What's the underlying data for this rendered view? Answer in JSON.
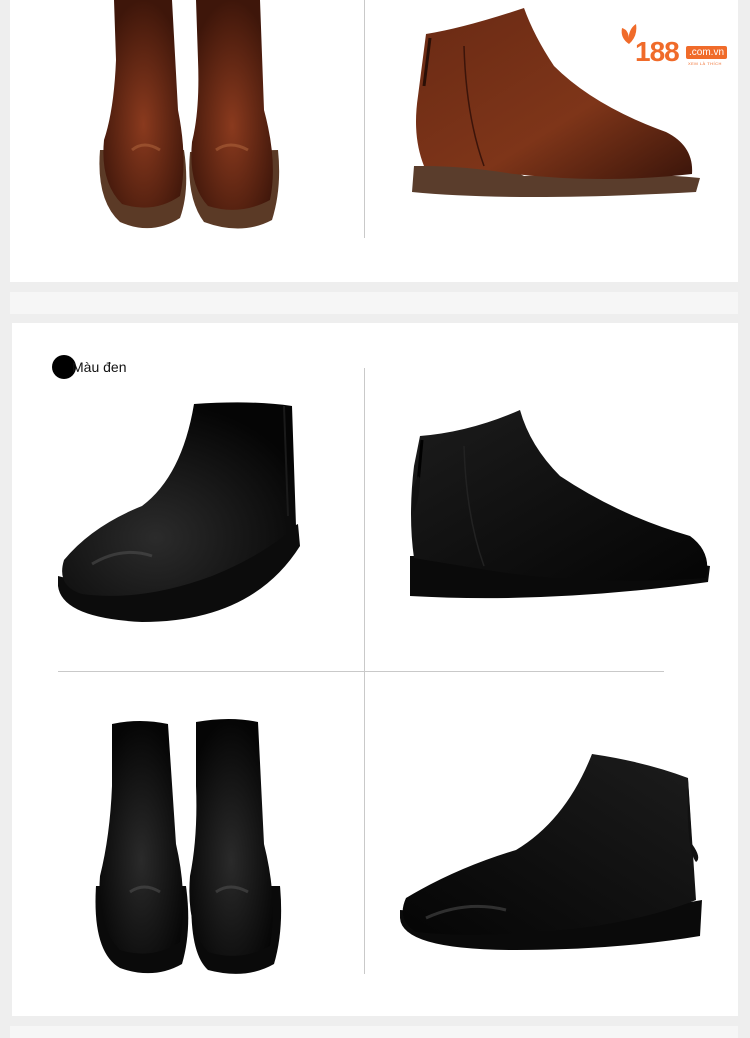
{
  "brand": {
    "logo_number": "188",
    "logo_domain": ".com.vn",
    "logo_tagline": "XEM LÀ THÍCH",
    "accent_color": "#f06b2a"
  },
  "colors_section": {
    "variant_label": "Màu đen",
    "swatch_color": "#000000"
  },
  "images": [
    {
      "name": "brown-boots-front-pair",
      "color": "brown"
    },
    {
      "name": "brown-boot-back-side",
      "color": "brown"
    },
    {
      "name": "black-boot-three-quarter",
      "color": "black"
    },
    {
      "name": "black-boot-back-side",
      "color": "black"
    },
    {
      "name": "black-boots-front-pair",
      "color": "black"
    },
    {
      "name": "black-boot-side-zip",
      "color": "black"
    }
  ]
}
